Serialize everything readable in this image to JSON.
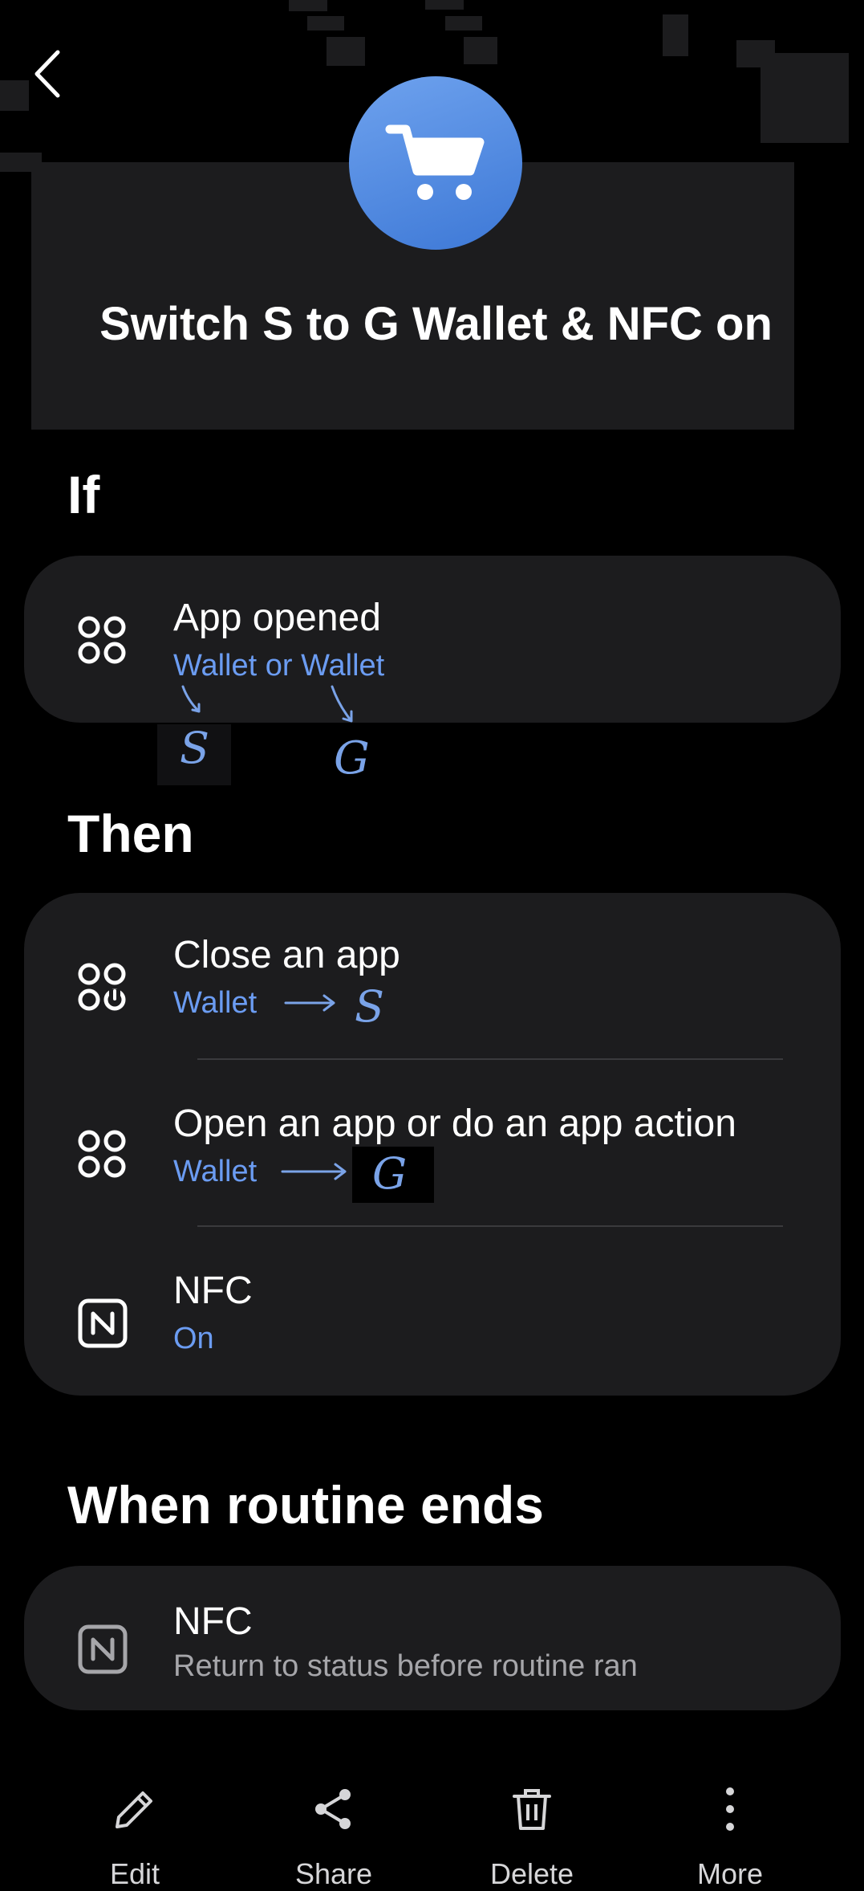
{
  "header": {
    "title": "Switch S to G Wallet & NFC on"
  },
  "if_section": {
    "heading": "If",
    "condition": {
      "title": "App opened",
      "subtitle": "Wallet or Wallet"
    },
    "handwritten": [
      "S",
      "G"
    ]
  },
  "then_section": {
    "heading": "Then",
    "actions": [
      {
        "title": "Close an app",
        "subtitle": "Wallet",
        "note": "S"
      },
      {
        "title": "Open an app or do an app action",
        "subtitle": "Wallet",
        "note": "G"
      },
      {
        "title": "NFC",
        "subtitle": "On"
      }
    ]
  },
  "ends_section": {
    "heading": "When routine ends",
    "item": {
      "title": "NFC",
      "subtitle": "Return to status before routine ran"
    }
  },
  "bottom_nav": {
    "edit": "Edit",
    "share": "Share",
    "delete": "Delete",
    "more": "More"
  },
  "colors": {
    "background": "#000000",
    "card": "#1c1c1e",
    "accent": "#6b9cf2",
    "icon_circle": "#4a86e0"
  }
}
